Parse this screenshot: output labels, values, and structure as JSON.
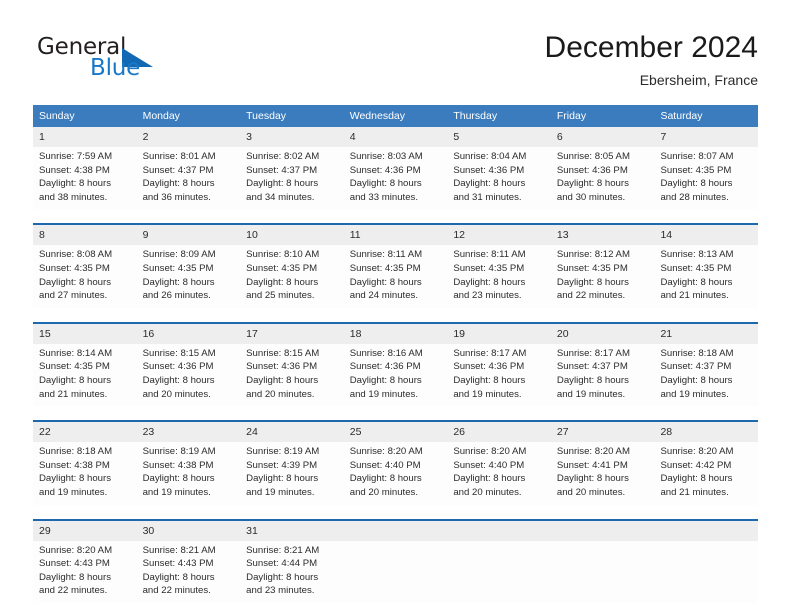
{
  "brand": {
    "name_part1": "General",
    "name_part2": "Blue",
    "triangle_color": "#1268b3",
    "accent_color": "#1878c8"
  },
  "header": {
    "title": "December 2024",
    "location": "Ebersheim, France"
  },
  "calendar": {
    "header_bg": "#3b7cbe",
    "week_divider_color": "#1e69ae",
    "daynum_bg": "#eeeeee",
    "weekdays": [
      "Sunday",
      "Monday",
      "Tuesday",
      "Wednesday",
      "Thursday",
      "Friday",
      "Saturday"
    ],
    "weeks": [
      {
        "days": [
          {
            "num": "1",
            "sunrise": "Sunrise: 7:59 AM",
            "sunset": "Sunset: 4:38 PM",
            "daylight1": "Daylight: 8 hours",
            "daylight2": "and 38 minutes."
          },
          {
            "num": "2",
            "sunrise": "Sunrise: 8:01 AM",
            "sunset": "Sunset: 4:37 PM",
            "daylight1": "Daylight: 8 hours",
            "daylight2": "and 36 minutes."
          },
          {
            "num": "3",
            "sunrise": "Sunrise: 8:02 AM",
            "sunset": "Sunset: 4:37 PM",
            "daylight1": "Daylight: 8 hours",
            "daylight2": "and 34 minutes."
          },
          {
            "num": "4",
            "sunrise": "Sunrise: 8:03 AM",
            "sunset": "Sunset: 4:36 PM",
            "daylight1": "Daylight: 8 hours",
            "daylight2": "and 33 minutes."
          },
          {
            "num": "5",
            "sunrise": "Sunrise: 8:04 AM",
            "sunset": "Sunset: 4:36 PM",
            "daylight1": "Daylight: 8 hours",
            "daylight2": "and 31 minutes."
          },
          {
            "num": "6",
            "sunrise": "Sunrise: 8:05 AM",
            "sunset": "Sunset: 4:36 PM",
            "daylight1": "Daylight: 8 hours",
            "daylight2": "and 30 minutes."
          },
          {
            "num": "7",
            "sunrise": "Sunrise: 8:07 AM",
            "sunset": "Sunset: 4:35 PM",
            "daylight1": "Daylight: 8 hours",
            "daylight2": "and 28 minutes."
          }
        ]
      },
      {
        "days": [
          {
            "num": "8",
            "sunrise": "Sunrise: 8:08 AM",
            "sunset": "Sunset: 4:35 PM",
            "daylight1": "Daylight: 8 hours",
            "daylight2": "and 27 minutes."
          },
          {
            "num": "9",
            "sunrise": "Sunrise: 8:09 AM",
            "sunset": "Sunset: 4:35 PM",
            "daylight1": "Daylight: 8 hours",
            "daylight2": "and 26 minutes."
          },
          {
            "num": "10",
            "sunrise": "Sunrise: 8:10 AM",
            "sunset": "Sunset: 4:35 PM",
            "daylight1": "Daylight: 8 hours",
            "daylight2": "and 25 minutes."
          },
          {
            "num": "11",
            "sunrise": "Sunrise: 8:11 AM",
            "sunset": "Sunset: 4:35 PM",
            "daylight1": "Daylight: 8 hours",
            "daylight2": "and 24 minutes."
          },
          {
            "num": "12",
            "sunrise": "Sunrise: 8:11 AM",
            "sunset": "Sunset: 4:35 PM",
            "daylight1": "Daylight: 8 hours",
            "daylight2": "and 23 minutes."
          },
          {
            "num": "13",
            "sunrise": "Sunrise: 8:12 AM",
            "sunset": "Sunset: 4:35 PM",
            "daylight1": "Daylight: 8 hours",
            "daylight2": "and 22 minutes."
          },
          {
            "num": "14",
            "sunrise": "Sunrise: 8:13 AM",
            "sunset": "Sunset: 4:35 PM",
            "daylight1": "Daylight: 8 hours",
            "daylight2": "and 21 minutes."
          }
        ]
      },
      {
        "days": [
          {
            "num": "15",
            "sunrise": "Sunrise: 8:14 AM",
            "sunset": "Sunset: 4:35 PM",
            "daylight1": "Daylight: 8 hours",
            "daylight2": "and 21 minutes."
          },
          {
            "num": "16",
            "sunrise": "Sunrise: 8:15 AM",
            "sunset": "Sunset: 4:36 PM",
            "daylight1": "Daylight: 8 hours",
            "daylight2": "and 20 minutes."
          },
          {
            "num": "17",
            "sunrise": "Sunrise: 8:15 AM",
            "sunset": "Sunset: 4:36 PM",
            "daylight1": "Daylight: 8 hours",
            "daylight2": "and 20 minutes."
          },
          {
            "num": "18",
            "sunrise": "Sunrise: 8:16 AM",
            "sunset": "Sunset: 4:36 PM",
            "daylight1": "Daylight: 8 hours",
            "daylight2": "and 19 minutes."
          },
          {
            "num": "19",
            "sunrise": "Sunrise: 8:17 AM",
            "sunset": "Sunset: 4:36 PM",
            "daylight1": "Daylight: 8 hours",
            "daylight2": "and 19 minutes."
          },
          {
            "num": "20",
            "sunrise": "Sunrise: 8:17 AM",
            "sunset": "Sunset: 4:37 PM",
            "daylight1": "Daylight: 8 hours",
            "daylight2": "and 19 minutes."
          },
          {
            "num": "21",
            "sunrise": "Sunrise: 8:18 AM",
            "sunset": "Sunset: 4:37 PM",
            "daylight1": "Daylight: 8 hours",
            "daylight2": "and 19 minutes."
          }
        ]
      },
      {
        "days": [
          {
            "num": "22",
            "sunrise": "Sunrise: 8:18 AM",
            "sunset": "Sunset: 4:38 PM",
            "daylight1": "Daylight: 8 hours",
            "daylight2": "and 19 minutes."
          },
          {
            "num": "23",
            "sunrise": "Sunrise: 8:19 AM",
            "sunset": "Sunset: 4:38 PM",
            "daylight1": "Daylight: 8 hours",
            "daylight2": "and 19 minutes."
          },
          {
            "num": "24",
            "sunrise": "Sunrise: 8:19 AM",
            "sunset": "Sunset: 4:39 PM",
            "daylight1": "Daylight: 8 hours",
            "daylight2": "and 19 minutes."
          },
          {
            "num": "25",
            "sunrise": "Sunrise: 8:20 AM",
            "sunset": "Sunset: 4:40 PM",
            "daylight1": "Daylight: 8 hours",
            "daylight2": "and 20 minutes."
          },
          {
            "num": "26",
            "sunrise": "Sunrise: 8:20 AM",
            "sunset": "Sunset: 4:40 PM",
            "daylight1": "Daylight: 8 hours",
            "daylight2": "and 20 minutes."
          },
          {
            "num": "27",
            "sunrise": "Sunrise: 8:20 AM",
            "sunset": "Sunset: 4:41 PM",
            "daylight1": "Daylight: 8 hours",
            "daylight2": "and 20 minutes."
          },
          {
            "num": "28",
            "sunrise": "Sunrise: 8:20 AM",
            "sunset": "Sunset: 4:42 PM",
            "daylight1": "Daylight: 8 hours",
            "daylight2": "and 21 minutes."
          }
        ]
      },
      {
        "days": [
          {
            "num": "29",
            "sunrise": "Sunrise: 8:20 AM",
            "sunset": "Sunset: 4:43 PM",
            "daylight1": "Daylight: 8 hours",
            "daylight2": "and 22 minutes."
          },
          {
            "num": "30",
            "sunrise": "Sunrise: 8:21 AM",
            "sunset": "Sunset: 4:43 PM",
            "daylight1": "Daylight: 8 hours",
            "daylight2": "and 22 minutes."
          },
          {
            "num": "31",
            "sunrise": "Sunrise: 8:21 AM",
            "sunset": "Sunset: 4:44 PM",
            "daylight1": "Daylight: 8 hours",
            "daylight2": "and 23 minutes."
          },
          {
            "num": "",
            "sunrise": "",
            "sunset": "",
            "daylight1": "",
            "daylight2": ""
          },
          {
            "num": "",
            "sunrise": "",
            "sunset": "",
            "daylight1": "",
            "daylight2": ""
          },
          {
            "num": "",
            "sunrise": "",
            "sunset": "",
            "daylight1": "",
            "daylight2": ""
          },
          {
            "num": "",
            "sunrise": "",
            "sunset": "",
            "daylight1": "",
            "daylight2": ""
          }
        ]
      }
    ]
  }
}
